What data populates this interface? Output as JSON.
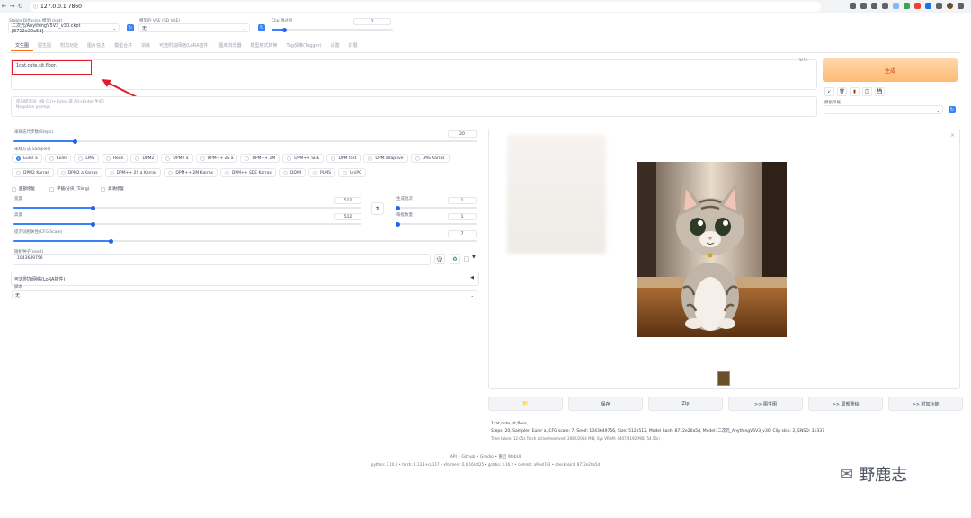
{
  "browser": {
    "url": "127.0.0.1:7860"
  },
  "top": {
    "model_label": "Stable Diffusion 模型(ckpt)",
    "model_value": "二次元/AnythingV5V3_v30.ckpt [8712e20a5d]",
    "vae_label": "模型的 VAE (SD VAE)",
    "vae_value": "无",
    "clip_label": "Clip 跳过层",
    "clip_value": "2"
  },
  "tabs": [
    "文生图",
    "图生图",
    "附加功能",
    "图片信息",
    "模型合并",
    "训练",
    "可选附加网络(LoRA插件)",
    "图库浏览器",
    "模型格式转换",
    "Tag反推(Tagger)",
    "设置",
    "扩展"
  ],
  "prompt": {
    "value": "1cat,cute,sit,floor,",
    "counter": "5/75",
    "neg_placeholder_1": "反向提示词（按 Ctrl+Enter 或 Alt+Enter 生成）",
    "neg_placeholder_2": "Negative prompt"
  },
  "generate_label": "生成",
  "styles": {
    "label": "模板风格",
    "value": ""
  },
  "steps": {
    "label": "采样迭代步数(Steps)",
    "value": "20",
    "fraction": 0.133
  },
  "sampler": {
    "label": "采样方法(Sampler)",
    "row1": [
      "Euler a",
      "Euler",
      "LMS",
      "Heun",
      "DPM2",
      "DPM2 a",
      "DPM++ 2S a",
      "DPM++ 2M",
      "DPM++ SDE",
      "DPM fast",
      "DPM adaptive",
      "LMS Karras"
    ],
    "row2": [
      "DPM2 Karras",
      "DPM2 a Karras",
      "DPM++ 2S a Karras",
      "DPM++ 2M Karras",
      "DPM++ SDE Karras",
      "DDIM",
      "PLMS",
      "UniPC"
    ]
  },
  "checks": [
    "面部修复",
    "平铺/分块 (Tiling)",
    "高清修复"
  ],
  "width": {
    "label": "宽度",
    "value": "512"
  },
  "height": {
    "label": "高度",
    "value": "512"
  },
  "swap_icon": "⇅",
  "batch_count": {
    "label": "生成批次",
    "value": "1"
  },
  "batch_size": {
    "label": "每批数量",
    "value": "1"
  },
  "cfg": {
    "label": "提示词相关性(CFG Scale)",
    "value": "7"
  },
  "seed": {
    "label": "随机种子(seed)",
    "value": "1043649756"
  },
  "lora": {
    "title": "可选附加网络(LoRA插件)",
    "script_label": "脚本",
    "script_value": "无"
  },
  "output_buttons": [
    "📁",
    "保存",
    "Zip",
    ">> 图生图",
    ">> 局部重绘",
    ">> 附加功能"
  ],
  "info": {
    "line1": "1cat,cute,sit,floor,",
    "line2": "Steps: 20, Sampler: Euler a, CFG scale: 7, Seed: 1043649756, Size: 512x512, Model hash: 8712e20a5d, Model: 二次元_AnythingV5V3_v30, Clip skip: 2, ENSD: 31337",
    "line3": "Time taken: 12.05s  Torch active/reserved: 2082/2954 MiB, Sys VRAM: 4407/8192 MiB (54.5%)"
  },
  "footer": {
    "links": "API  •  Github  •  Gradio  •  重启 WebUI",
    "versions": "python: 3.10.6  •  torch: 1.13.1+cu117  •  xformers: 0.0.16rc425  •  gradio: 3.16.2  •  commit: a9fed7c3  •  checkpoint: 8712e20a5d"
  },
  "watermark": "野鹿志",
  "colors": {
    "accent": "#f97316",
    "primary": "#3b82f6",
    "annotation": "#e11d2b"
  }
}
